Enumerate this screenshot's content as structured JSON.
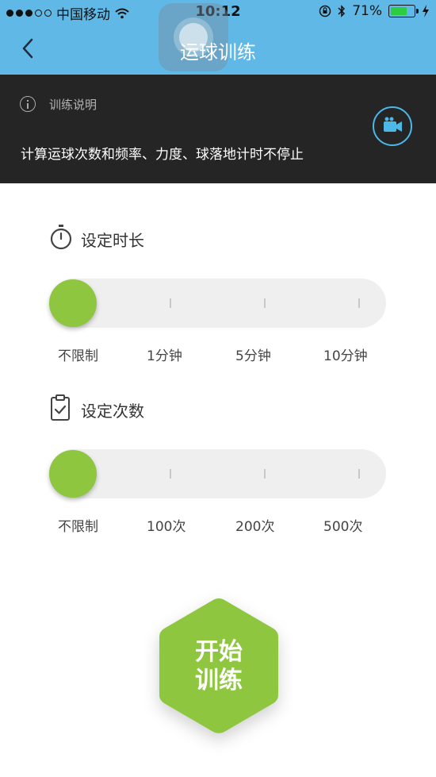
{
  "status_bar": {
    "carrier": "中国移动",
    "time": "10:12",
    "battery_percent": "71%",
    "battery_level": 0.71,
    "battery_color": "#2ecc40",
    "signal_icon": "signal-dots-icon",
    "wifi_icon": "wifi-icon",
    "bluetooth_icon": "bluetooth-icon",
    "rotation_lock_icon": "rotation-lock-icon",
    "charging_icon": "charging-bolt-icon"
  },
  "nav": {
    "title": "运球训练",
    "back_icon": "chevron-left-icon",
    "background_color": "#5fb8e5"
  },
  "info": {
    "label": "训练说明",
    "description": "计算运球次数和频率、力度、球落地计时不停止",
    "video_icon": "video-camera-icon",
    "accent_color": "#4bb8e8"
  },
  "duration": {
    "title": "设定时长",
    "icon": "stopwatch-icon",
    "options": [
      "不限制",
      "1分钟",
      "5分钟",
      "10分钟"
    ],
    "selected": "不限制"
  },
  "count": {
    "title": "设定次数",
    "icon": "clipboard-check-icon",
    "options": [
      "不限制",
      "100次",
      "200次",
      "500次"
    ],
    "selected": "不限制"
  },
  "start": {
    "line1": "开始",
    "line2": "训练",
    "color": "#8ec63f"
  }
}
